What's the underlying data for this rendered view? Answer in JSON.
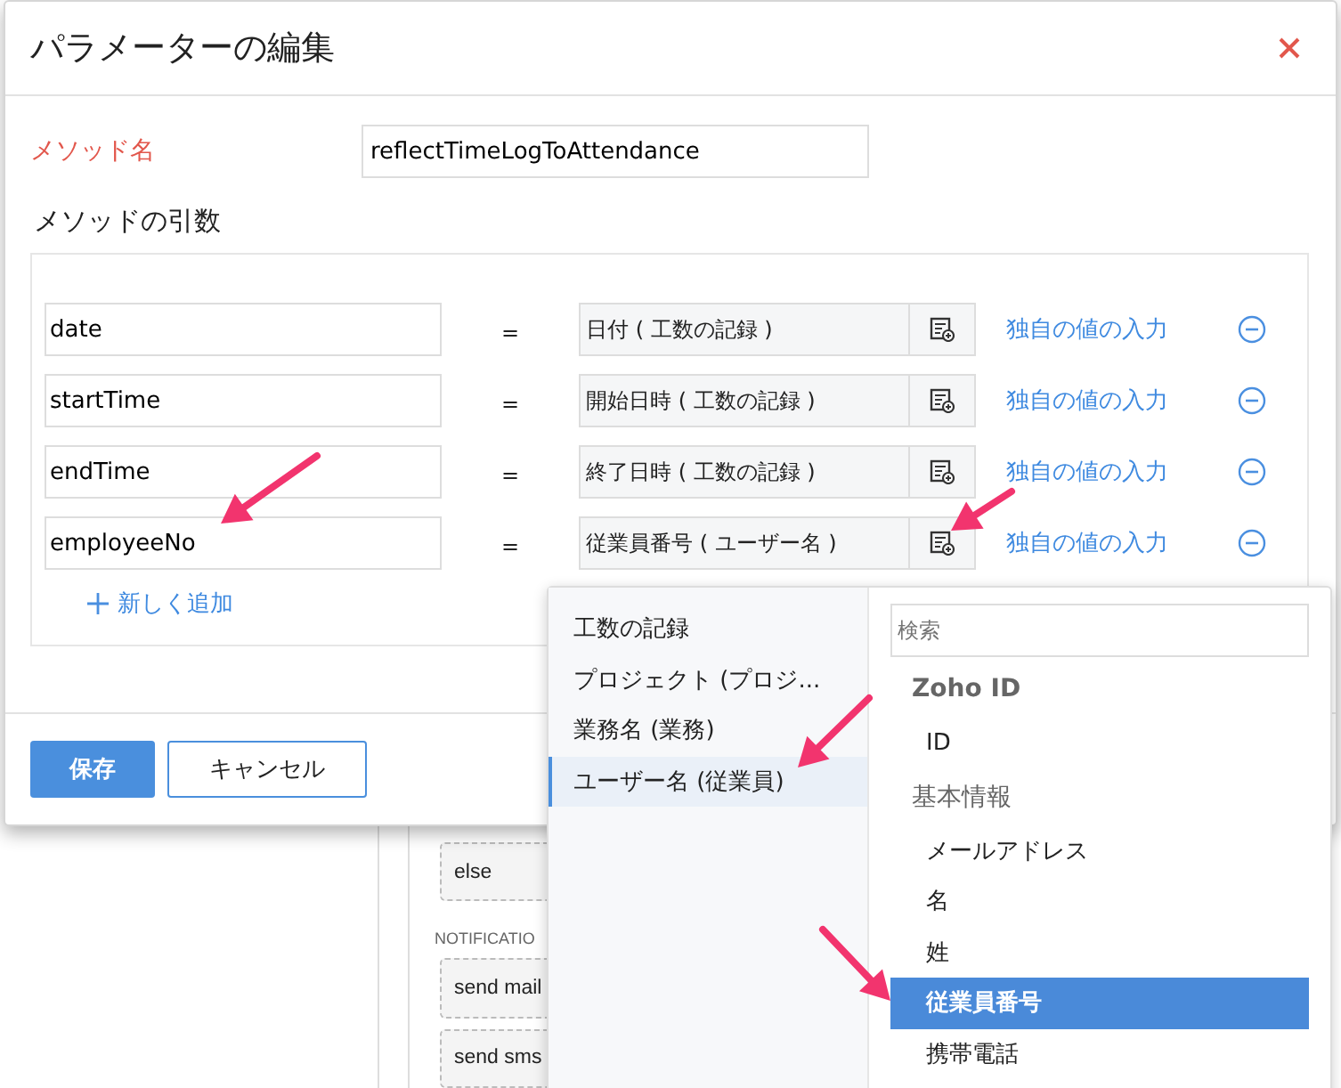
{
  "background": {
    "items": [
      {
        "label": "else",
        "kind": "block"
      },
      {
        "label": "NOTIFICATIO",
        "kind": "heading"
      },
      {
        "label": "send mail",
        "kind": "block"
      },
      {
        "label": "send sms",
        "kind": "block"
      }
    ]
  },
  "dialog": {
    "title": "パラメーターの編集",
    "method_name": {
      "label": "メソッド名",
      "value": "reflectTimeLogToAttendance"
    },
    "arguments_label": "メソッドの引数",
    "arguments": [
      {
        "name": "date",
        "equals": "=",
        "value": "日付 ( 工数の記録 )",
        "link": "独自の値の入力"
      },
      {
        "name": "startTime",
        "equals": "=",
        "value": "開始日時 ( 工数の記録 )",
        "link": "独自の値の入力"
      },
      {
        "name": "endTime",
        "equals": "=",
        "value": "終了日時 ( 工数の記録 )",
        "link": "独自の値の入力"
      },
      {
        "name": "employeeNo",
        "equals": "=",
        "value": "従業員番号 ( ユーザー名 )",
        "link": "独自の値の入力"
      }
    ],
    "add_link": "新しく追加",
    "buttons": [
      {
        "label": "保存",
        "kind": "primary"
      },
      {
        "label": "キャンセル",
        "kind": "secondary"
      }
    ]
  },
  "field_picker": {
    "modules": [
      {
        "label": "工数の記録",
        "selected": false
      },
      {
        "label": "プロジェクト (プロジ...",
        "selected": false
      },
      {
        "label": "業務名 (業務)",
        "selected": false
      },
      {
        "label": "ユーザー名 (従業員)",
        "selected": true
      }
    ],
    "search": {
      "placeholder": "検索"
    },
    "groups": [
      {
        "label": "Zoho ID",
        "bold": true,
        "fields": [
          {
            "label": "ID",
            "selected": false
          }
        ]
      },
      {
        "label": "基本情報",
        "bold": false,
        "fields": [
          {
            "label": "メールアドレス",
            "selected": false
          },
          {
            "label": "名",
            "selected": false
          },
          {
            "label": "姓",
            "selected": false
          },
          {
            "label": "従業員番号",
            "selected": true
          },
          {
            "label": "携帯電話",
            "selected": false
          }
        ]
      }
    ]
  }
}
